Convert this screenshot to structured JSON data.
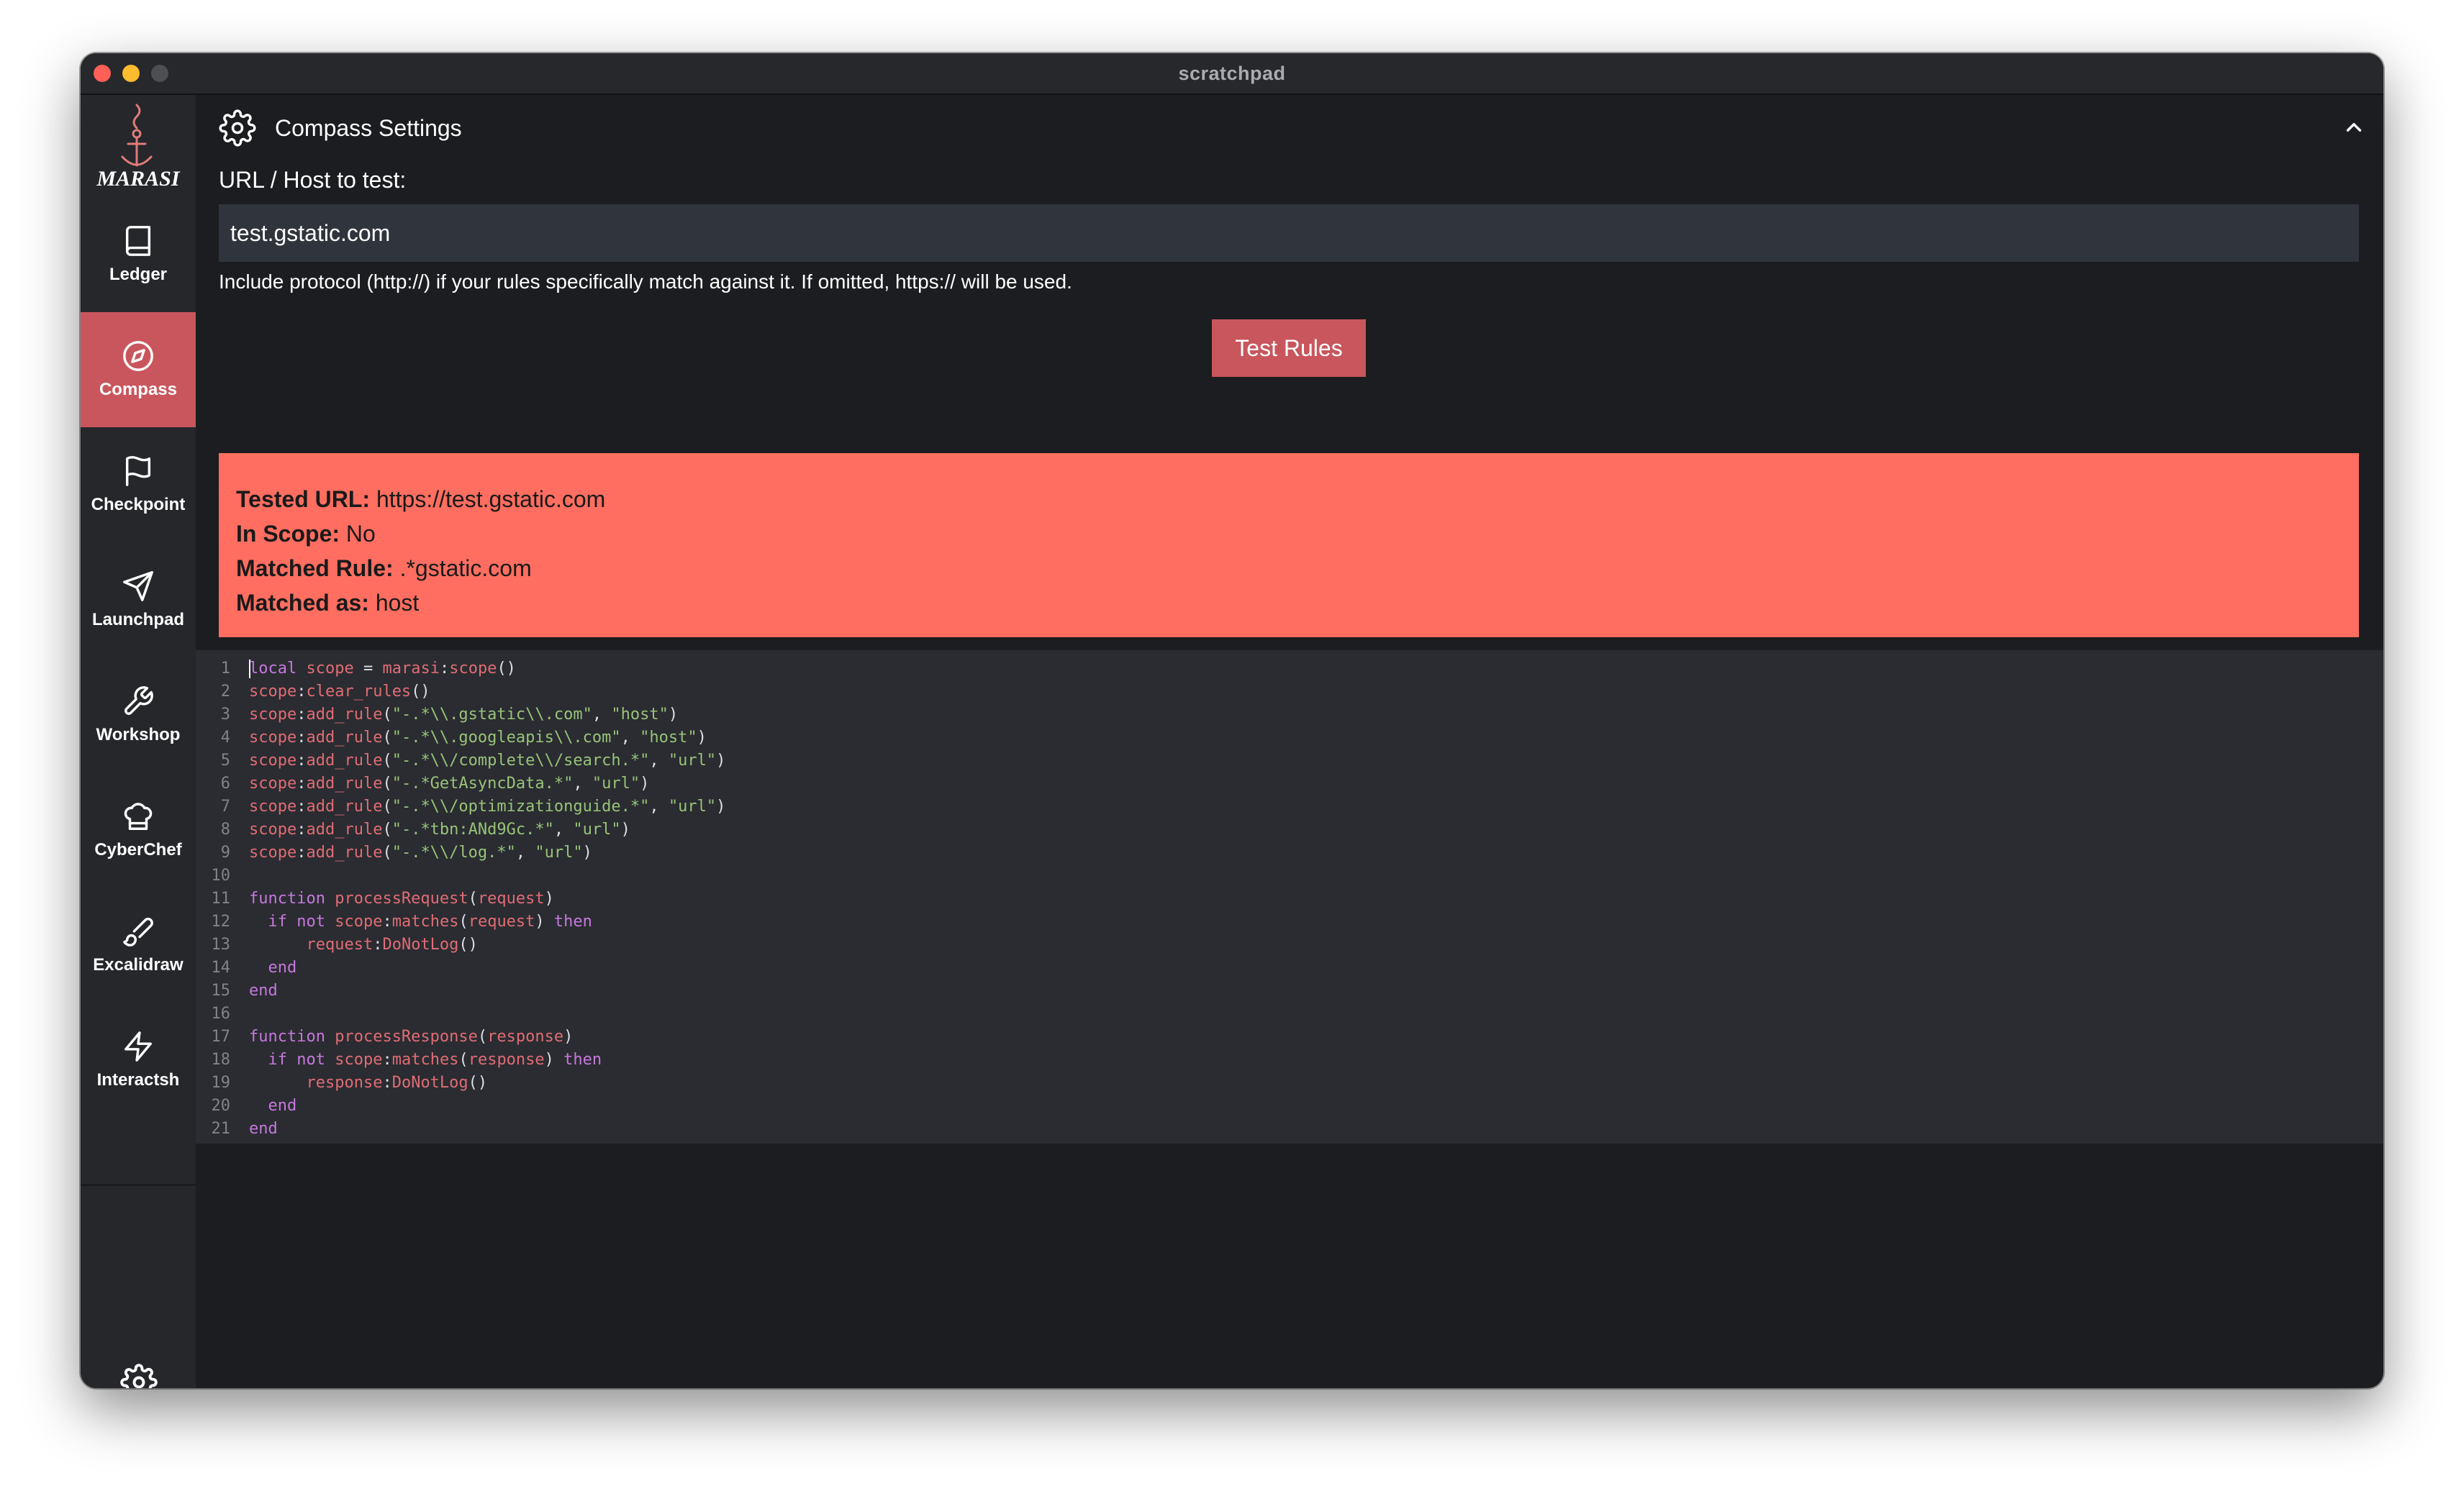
{
  "window": {
    "title": "scratchpad"
  },
  "sidebar": {
    "logo_text": "MARASI",
    "items": [
      {
        "label": "Ledger",
        "icon": "book-icon"
      },
      {
        "label": "Compass",
        "icon": "compass-icon",
        "active": true
      },
      {
        "label": "Checkpoint",
        "icon": "flag-icon"
      },
      {
        "label": "Launchpad",
        "icon": "send-icon"
      },
      {
        "label": "Workshop",
        "icon": "wrench-icon"
      },
      {
        "label": "CyberChef",
        "icon": "chef-hat-icon"
      },
      {
        "label": "Excalidraw",
        "icon": "brush-icon"
      },
      {
        "label": "Interactsh",
        "icon": "zap-icon"
      }
    ],
    "bottom_icon": "gear-icon"
  },
  "header": {
    "title": "Compass Settings",
    "icon": "gear-icon",
    "collapse_icon": "chevron-up-icon"
  },
  "form": {
    "url_label": "URL / Host to test:",
    "url_value": "test.gstatic.com",
    "hint": "Include protocol (http://) if your rules specifically match against it. If omitted, https:// will be used.",
    "test_button": "Test Rules"
  },
  "result": {
    "tested_url_label": "Tested URL:",
    "tested_url": "https://test.gstatic.com",
    "in_scope_label": "In Scope:",
    "in_scope": "No",
    "matched_rule_label": "Matched Rule:",
    "matched_rule": ".*gstatic.com",
    "matched_as_label": "Matched as:",
    "matched_as": "host"
  },
  "colors": {
    "accent": "#c9565d",
    "result_bg": "#ff6e60",
    "window_bg": "#1b1d20",
    "sidebar_bg": "#25272b",
    "editor_bg": "#2a2c31"
  },
  "editor": {
    "lines": [
      [
        [
          "kw",
          "local"
        ],
        [
          "plain",
          " "
        ],
        [
          "fn",
          "scope"
        ],
        [
          "plain",
          " = "
        ],
        [
          "fn",
          "marasi"
        ],
        [
          "plain",
          ":"
        ],
        [
          "fn",
          "scope"
        ],
        [
          "plain",
          "()"
        ]
      ],
      [
        [
          "fn",
          "scope"
        ],
        [
          "plain",
          ":"
        ],
        [
          "fn",
          "clear_rules"
        ],
        [
          "plain",
          "()"
        ]
      ],
      [
        [
          "fn",
          "scope"
        ],
        [
          "plain",
          ":"
        ],
        [
          "fn",
          "add_rule"
        ],
        [
          "plain",
          "("
        ],
        [
          "str",
          "\"-.*\\\\.gstatic\\\\.com\""
        ],
        [
          "plain",
          ", "
        ],
        [
          "str",
          "\"host\""
        ],
        [
          "plain",
          ")"
        ]
      ],
      [
        [
          "fn",
          "scope"
        ],
        [
          "plain",
          ":"
        ],
        [
          "fn",
          "add_rule"
        ],
        [
          "plain",
          "("
        ],
        [
          "str",
          "\"-.*\\\\.googleapis\\\\.com\""
        ],
        [
          "plain",
          ", "
        ],
        [
          "str",
          "\"host\""
        ],
        [
          "plain",
          ")"
        ]
      ],
      [
        [
          "fn",
          "scope"
        ],
        [
          "plain",
          ":"
        ],
        [
          "fn",
          "add_rule"
        ],
        [
          "plain",
          "("
        ],
        [
          "str",
          "\"-.*\\\\/complete\\\\/search.*\""
        ],
        [
          "plain",
          ", "
        ],
        [
          "str",
          "\"url\""
        ],
        [
          "plain",
          ")"
        ]
      ],
      [
        [
          "fn",
          "scope"
        ],
        [
          "plain",
          ":"
        ],
        [
          "fn",
          "add_rule"
        ],
        [
          "plain",
          "("
        ],
        [
          "str",
          "\"-.*GetAsyncData.*\""
        ],
        [
          "plain",
          ", "
        ],
        [
          "str",
          "\"url\""
        ],
        [
          "plain",
          ")"
        ]
      ],
      [
        [
          "fn",
          "scope"
        ],
        [
          "plain",
          ":"
        ],
        [
          "fn",
          "add_rule"
        ],
        [
          "plain",
          "("
        ],
        [
          "str",
          "\"-.*\\\\/optimizationguide.*\""
        ],
        [
          "plain",
          ", "
        ],
        [
          "str",
          "\"url\""
        ],
        [
          "plain",
          ")"
        ]
      ],
      [
        [
          "fn",
          "scope"
        ],
        [
          "plain",
          ":"
        ],
        [
          "fn",
          "add_rule"
        ],
        [
          "plain",
          "("
        ],
        [
          "str",
          "\"-.*tbn:ANd9Gc.*\""
        ],
        [
          "plain",
          ", "
        ],
        [
          "str",
          "\"url\""
        ],
        [
          "plain",
          ")"
        ]
      ],
      [
        [
          "fn",
          "scope"
        ],
        [
          "plain",
          ":"
        ],
        [
          "fn",
          "add_rule"
        ],
        [
          "plain",
          "("
        ],
        [
          "str",
          "\"-.*\\\\/log.*\""
        ],
        [
          "plain",
          ", "
        ],
        [
          "str",
          "\"url\""
        ],
        [
          "plain",
          ")"
        ]
      ],
      [],
      [
        [
          "kw",
          "function"
        ],
        [
          "plain",
          " "
        ],
        [
          "fn",
          "processRequest"
        ],
        [
          "plain",
          "("
        ],
        [
          "fn",
          "request"
        ],
        [
          "plain",
          ")"
        ]
      ],
      [
        [
          "plain",
          "  "
        ],
        [
          "kw",
          "if"
        ],
        [
          "plain",
          " "
        ],
        [
          "kw",
          "not"
        ],
        [
          "plain",
          " "
        ],
        [
          "fn",
          "scope"
        ],
        [
          "plain",
          ":"
        ],
        [
          "fn",
          "matches"
        ],
        [
          "plain",
          "("
        ],
        [
          "fn",
          "request"
        ],
        [
          "plain",
          ") "
        ],
        [
          "kw",
          "then"
        ]
      ],
      [
        [
          "plain",
          "      "
        ],
        [
          "fn",
          "request"
        ],
        [
          "plain",
          ":"
        ],
        [
          "fn",
          "DoNotLog"
        ],
        [
          "plain",
          "()"
        ]
      ],
      [
        [
          "plain",
          "  "
        ],
        [
          "kw",
          "end"
        ]
      ],
      [
        [
          "kw",
          "end"
        ]
      ],
      [],
      [
        [
          "kw",
          "function"
        ],
        [
          "plain",
          " "
        ],
        [
          "fn",
          "processResponse"
        ],
        [
          "plain",
          "("
        ],
        [
          "fn",
          "response"
        ],
        [
          "plain",
          ")"
        ]
      ],
      [
        [
          "plain",
          "  "
        ],
        [
          "kw",
          "if"
        ],
        [
          "plain",
          " "
        ],
        [
          "kw",
          "not"
        ],
        [
          "plain",
          " "
        ],
        [
          "fn",
          "scope"
        ],
        [
          "plain",
          ":"
        ],
        [
          "fn",
          "matches"
        ],
        [
          "plain",
          "("
        ],
        [
          "fn",
          "response"
        ],
        [
          "plain",
          ") "
        ],
        [
          "kw",
          "then"
        ]
      ],
      [
        [
          "plain",
          "      "
        ],
        [
          "fn",
          "response"
        ],
        [
          "plain",
          ":"
        ],
        [
          "fn",
          "DoNotLog"
        ],
        [
          "plain",
          "()"
        ]
      ],
      [
        [
          "plain",
          "  "
        ],
        [
          "kw",
          "end"
        ]
      ],
      [
        [
          "kw",
          "end"
        ]
      ]
    ]
  }
}
